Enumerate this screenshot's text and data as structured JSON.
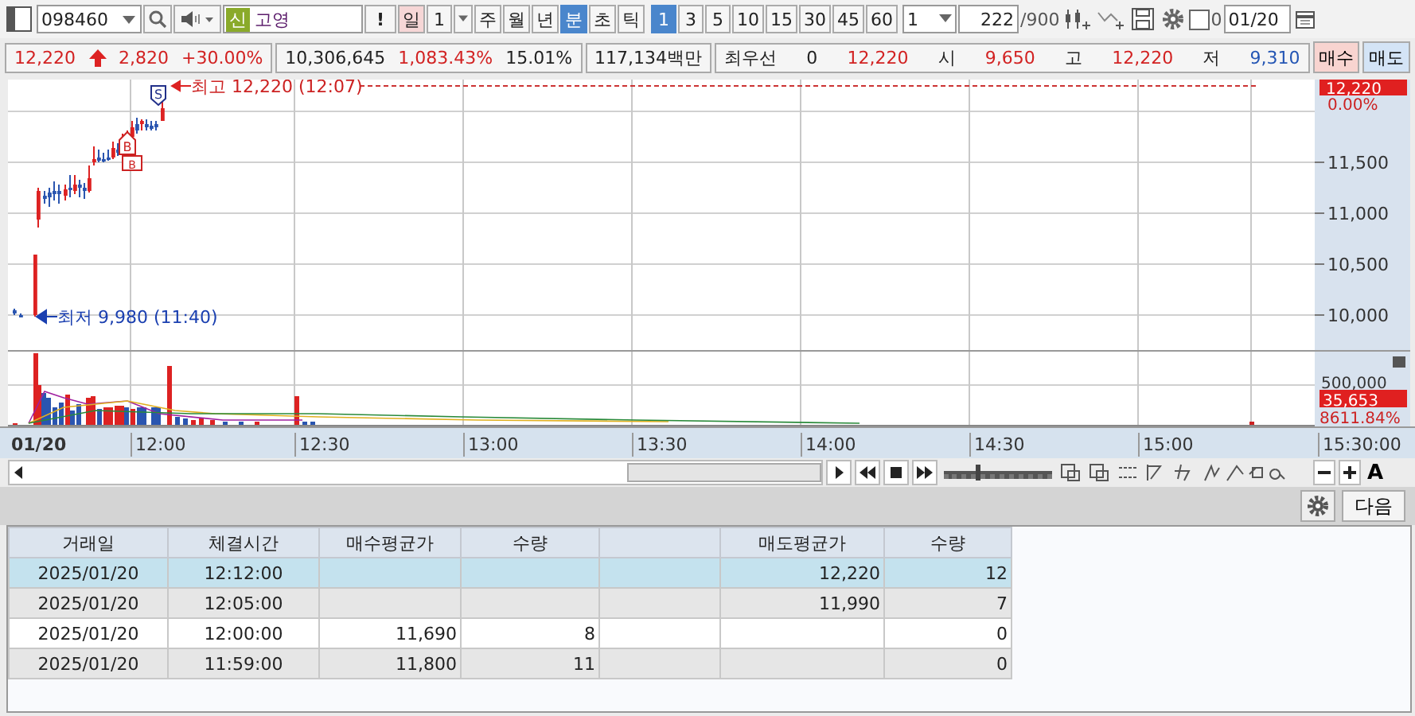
{
  "toolbar": {
    "code": "098460",
    "badge": "신",
    "name": "고영",
    "alert": "!",
    "periods": [
      {
        "label": "일",
        "kind": "day",
        "selected": false
      },
      {
        "label": "1",
        "kind": "num",
        "selected": false
      },
      {
        "label": "주",
        "kind": "plain",
        "selected": false
      },
      {
        "label": "월",
        "kind": "plain",
        "selected": false
      },
      {
        "label": "년",
        "kind": "plain",
        "selected": false
      },
      {
        "label": "분",
        "kind": "plain",
        "selected": true
      },
      {
        "label": "초",
        "kind": "plain",
        "selected": false
      },
      {
        "label": "틱",
        "kind": "plain",
        "selected": false
      }
    ],
    "intervals": [
      {
        "label": "1",
        "selected": true
      },
      {
        "label": "3",
        "selected": false
      },
      {
        "label": "5",
        "selected": false
      },
      {
        "label": "10",
        "selected": false
      },
      {
        "label": "15",
        "selected": false
      },
      {
        "label": "30",
        "selected": false
      },
      {
        "label": "45",
        "selected": false
      },
      {
        "label": "60",
        "selected": false
      }
    ],
    "unit": "1",
    "count": "222",
    "count_max": "/900",
    "option": {
      "label": "0",
      "checked": false
    },
    "date": "01/20"
  },
  "quote": [
    [
      {
        "text": "12,220",
        "color": "#d22222",
        "arrow": true
      },
      {
        "text": "2,820",
        "color": "#d22222"
      },
      {
        "text": "+30.00%",
        "color": "#d22222"
      }
    ],
    [
      {
        "text": "10,306,645",
        "color": "#222222"
      },
      {
        "text": "1,083.43%",
        "color": "#d22222"
      },
      {
        "text": "15.01%",
        "color": "#222222"
      }
    ],
    [
      {
        "text": "117,134백만",
        "color": "#222222"
      }
    ],
    [
      {
        "text": "최우선",
        "color": "#222222"
      },
      {
        "text": "0",
        "color": "#222222"
      },
      {
        "text": "12,220",
        "color": "#d22222"
      },
      {
        "text": "시",
        "color": "#222222"
      },
      {
        "text": "9,650",
        "color": "#d22222"
      },
      {
        "text": "고",
        "color": "#222222"
      },
      {
        "text": "12,220",
        "color": "#d22222"
      },
      {
        "text": "저",
        "color": "#222222"
      },
      {
        "text": "9,310",
        "color": "#2456b4"
      }
    ]
  ],
  "trade_buttons": [
    {
      "label": "매수",
      "kind": "buy"
    },
    {
      "label": "매도",
      "kind": "sell"
    }
  ],
  "chart": {
    "high_note": "최고 12,220 (12:07)",
    "low_note": "최저 9,980 (11:40)",
    "sell_mark": "S",
    "buy_mark": "B",
    "buy_mark_2": "B",
    "price_badge": "12,220",
    "price_change": "0.00%",
    "price_ticks": [
      "11,500",
      "11,000",
      "10,500",
      "10,000"
    ],
    "volume_tick": "500,000",
    "volume_badge": "35,653",
    "volume_ratio": "8611.84%",
    "date_label": "01/20",
    "time_labels": [
      "12:00",
      "12:30",
      "13:00",
      "13:30",
      "14:00",
      "14:30",
      "15:00"
    ],
    "end_time": "15:30:00"
  },
  "zoom_slider": {
    "level": 0.3
  },
  "font_button": "A",
  "next_button": "다음",
  "table": {
    "columns": [
      "거래일",
      "체결시간",
      "매수평균가",
      "수량",
      "",
      "매도평균가",
      "수량"
    ],
    "rows": [
      {
        "selected": true,
        "cells": [
          "2025/01/20",
          "12:12:00",
          "",
          "",
          "",
          "12,220",
          "12"
        ]
      },
      {
        "selected": false,
        "cells": [
          "2025/01/20",
          "12:05:00",
          "",
          "",
          "",
          "11,990",
          "7"
        ]
      },
      {
        "selected": false,
        "cells": [
          "2025/01/20",
          "12:00:00",
          "11,690",
          "8",
          "",
          "",
          "0"
        ]
      },
      {
        "selected": false,
        "cells": [
          "2025/01/20",
          "11:59:00",
          "11,800",
          "11",
          "",
          "",
          "0"
        ]
      }
    ]
  }
}
